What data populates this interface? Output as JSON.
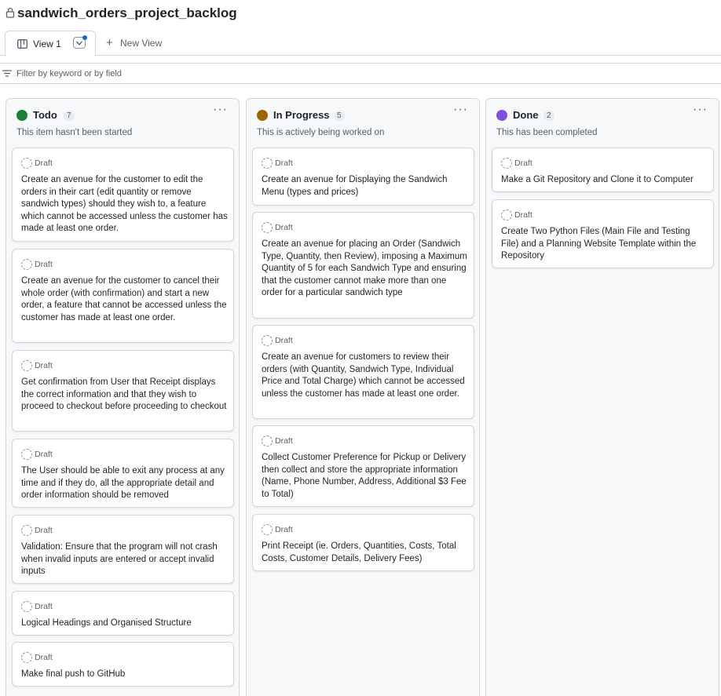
{
  "project": {
    "title": "sandwich_orders_project_backlog"
  },
  "views": {
    "active_label": "View 1",
    "new_view_label": "New View"
  },
  "filter": {
    "placeholder": "Filter by keyword or by field"
  },
  "draft_label": "Draft",
  "columns": [
    {
      "name": "Todo",
      "count": "7",
      "color": "#1a7f37",
      "description": "This item hasn't been started",
      "cards": [
        "Create an avenue for the customer to edit the orders in their cart (edit quantity or remove sandwich types) should they wish to, a feature which cannot be accessed unless the customer has made at least one order.",
        "Create an avenue for the customer to cancel their whole order (with confirmation) and start a new order, a feature that cannot be accessed unless the customer has made at least one order.",
        "Get confirmation from User that Receipt displays the correct information and that they wish to proceed to checkout before proceeding to checkout",
        "The User should be able to exit any process at any time and if they do, all the appropriate detail and order information should be removed",
        "Validation: Ensure that the program will not crash when invalid inputs are entered or accept invalid inputs",
        "Logical Headings and Organised Structure",
        "Make final push to GitHub"
      ]
    },
    {
      "name": "In Progress",
      "count": "5",
      "color": "#9a6700",
      "description": "This is actively being worked on",
      "cards": [
        "Create an avenue for Displaying the Sandwich Menu (types and prices)",
        "Create an avenue for placing an Order (Sandwich Type, Quantity, then Review), imposing a Maximum Quantity of 5 for each Sandwich Type and ensuring that the customer cannot make more than one order for a particular sandwich type",
        "Create an avenue for customers to review their orders (with Quantity, Sandwich Type, Individual Price and Total Charge) which cannot be accessed unless the customer has made at least one order.",
        "Collect Customer Preference for Pickup or Delivery then collect and store the appropriate information (Name, Phone Number, Address, Additional $3 Fee to Total)",
        "Print Receipt (ie. Orders, Quantities, Costs, Total Costs, Customer Details, Delivery Fees)"
      ]
    },
    {
      "name": "Done",
      "count": "2",
      "color": "#8250df",
      "description": "This has been completed",
      "cards": [
        "Make a Git Repository and Clone it to Computer",
        "Create Two Python Files (Main File and Testing File) and a Planning Website Template within the Repository"
      ]
    }
  ],
  "icons": {
    "lock": "lock-icon",
    "board": "board-icon",
    "plus": "plus-icon",
    "filter": "filter-icon",
    "menu": "kebab-menu-icon",
    "draft": "draft-icon"
  }
}
